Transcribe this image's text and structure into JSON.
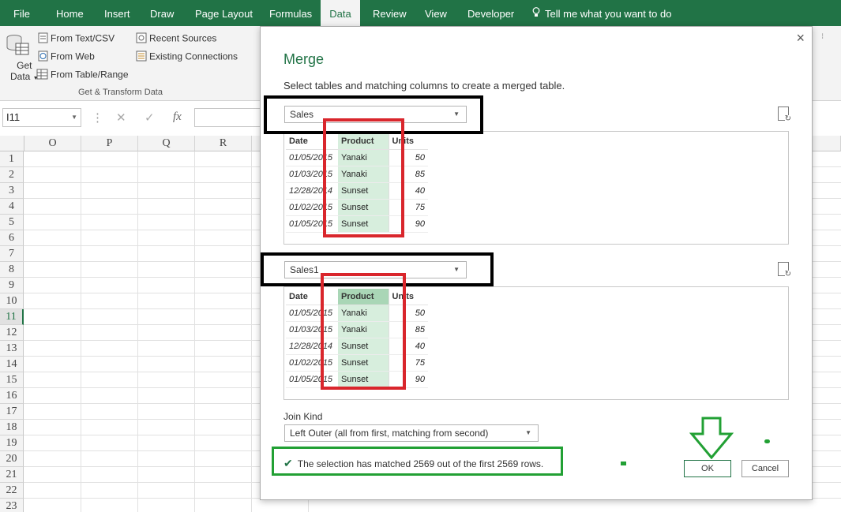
{
  "ribbon": {
    "tabs": [
      {
        "label": "File",
        "active": false
      },
      {
        "label": "Home",
        "active": false
      },
      {
        "label": "Insert",
        "active": false
      },
      {
        "label": "Draw",
        "active": false
      },
      {
        "label": "Page Layout",
        "active": false
      },
      {
        "label": "Formulas",
        "active": false
      },
      {
        "label": "Data",
        "active": true
      },
      {
        "label": "Review",
        "active": false
      },
      {
        "label": "View",
        "active": false
      },
      {
        "label": "Developer",
        "active": false
      }
    ],
    "tell_me": "Tell me what you want to do",
    "get_data_label_1": "Get",
    "get_data_label_2": "Data",
    "commands": {
      "from_text": "From Text/CSV",
      "from_web": "From Web",
      "from_table": "From Table/Range",
      "recent_sources": "Recent Sources",
      "existing_connections": "Existing Connections"
    },
    "group_label": "Get & Transform Data",
    "accent_color": "#217346"
  },
  "formula_bar": {
    "name_box": "I11",
    "cancel_symbol": "✕",
    "enter_symbol": "✓",
    "fx_symbol": "fx"
  },
  "sheet": {
    "columns": [
      "O",
      "P",
      "Q",
      "R"
    ],
    "rows": [
      "1",
      "2",
      "3",
      "4",
      "5",
      "6",
      "7",
      "8",
      "9",
      "10",
      "11",
      "12",
      "13",
      "14",
      "15",
      "16",
      "17",
      "18",
      "19",
      "20",
      "21",
      "22",
      "23"
    ],
    "selected_row": "11"
  },
  "dialog": {
    "title": "Merge",
    "subtitle": "Select tables and matching columns to create a merged table.",
    "close_icon": "×",
    "table1": {
      "name": "Sales",
      "columns": [
        "Date",
        "Product",
        "Units"
      ],
      "rows": [
        [
          "01/05/2015",
          "Yanaki",
          "50"
        ],
        [
          "01/03/2015",
          "Yanaki",
          "85"
        ],
        [
          "12/28/2014",
          "Sunset",
          "40"
        ],
        [
          "01/02/2015",
          "Sunset",
          "75"
        ],
        [
          "01/05/2015",
          "Sunset",
          "90"
        ]
      ]
    },
    "table2": {
      "name": "Sales1",
      "columns": [
        "Date",
        "Product",
        "Units"
      ],
      "rows": [
        [
          "01/05/2015",
          "Yanaki",
          "50"
        ],
        [
          "01/03/2015",
          "Yanaki",
          "85"
        ],
        [
          "12/28/2014",
          "Sunset",
          "40"
        ],
        [
          "01/02/2015",
          "Sunset",
          "75"
        ],
        [
          "01/05/2015",
          "Sunset",
          "90"
        ]
      ]
    },
    "join_kind_label": "Join Kind",
    "join_kind_value": "Left Outer (all from first, matching from second)",
    "status_text": "The selection has matched 2569 out of the first 2569 rows.",
    "ok_label": "OK",
    "cancel_label": "Cancel"
  },
  "annotation_colors": {
    "black": "#000000",
    "red": "#d9262c",
    "green": "#22a034"
  }
}
